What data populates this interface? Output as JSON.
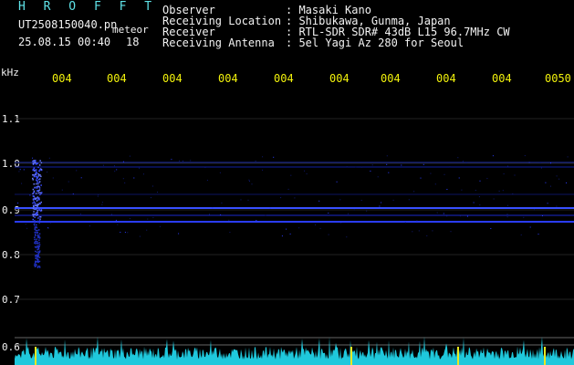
{
  "header": {
    "title": "H R O F F T",
    "file": "UT2508150040.pn",
    "meteor_label": "meteor",
    "date_time": "25.08.15 00:40",
    "count": "18"
  },
  "info": [
    {
      "label": "Observer",
      "value": ": Masaki Kano"
    },
    {
      "label": "Receiving Location",
      "value": ": Shibukawa, Gunma, Japan"
    },
    {
      "label": "Receiver",
      "value": ": RTL-SDR SDR# 43dB L15 96.7MHz CW"
    },
    {
      "label": "Receiving Antenna",
      "value": ": 5el Yagi Az 280 for Seoul"
    }
  ],
  "y_axis": {
    "unit": "kHz",
    "ticks": [
      "1.1",
      "1.0",
      "0.9",
      "0.8",
      "0.7",
      "0.6"
    ]
  },
  "x_axis": {
    "ticks": [
      "004",
      "004",
      "004",
      "004",
      "004",
      "004",
      "004",
      "004",
      "004",
      "0050"
    ]
  },
  "colors": {
    "title": "#5fe3e8",
    "text": "#f2f2f2",
    "time_ticks": "#f2f20c",
    "signal": "#2a3cff",
    "spectrum": "#22d0e0"
  }
}
